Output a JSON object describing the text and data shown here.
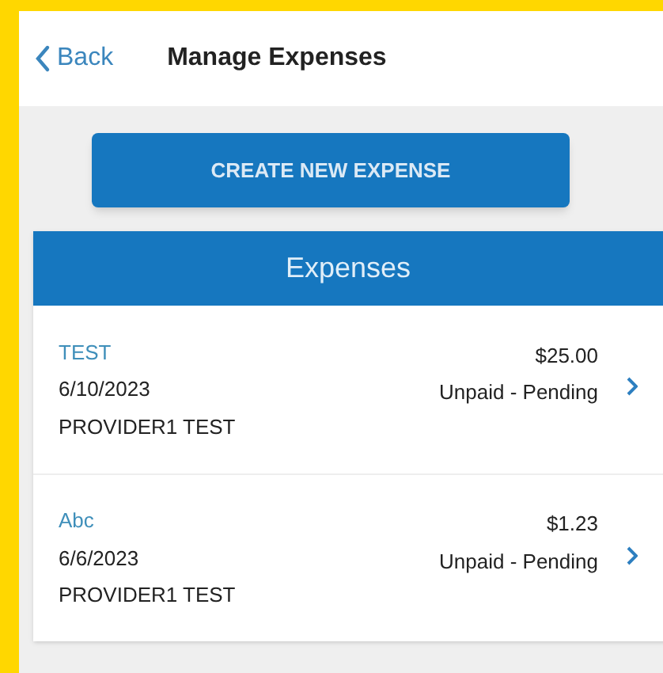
{
  "nav": {
    "back": "Back",
    "title": "Manage Expenses"
  },
  "create_button": "CREATE NEW EXPENSE",
  "list": {
    "title": "Expenses",
    "rows": [
      {
        "name": "TEST",
        "amount": "$25.00",
        "date": "6/10/2023",
        "status": "Unpaid - Pending",
        "provider": "PROVIDER1 TEST"
      },
      {
        "name": "Abc",
        "amount": "$1.23",
        "date": "6/6/2023",
        "status": "Unpaid - Pending",
        "provider": "PROVIDER1 TEST"
      }
    ]
  }
}
